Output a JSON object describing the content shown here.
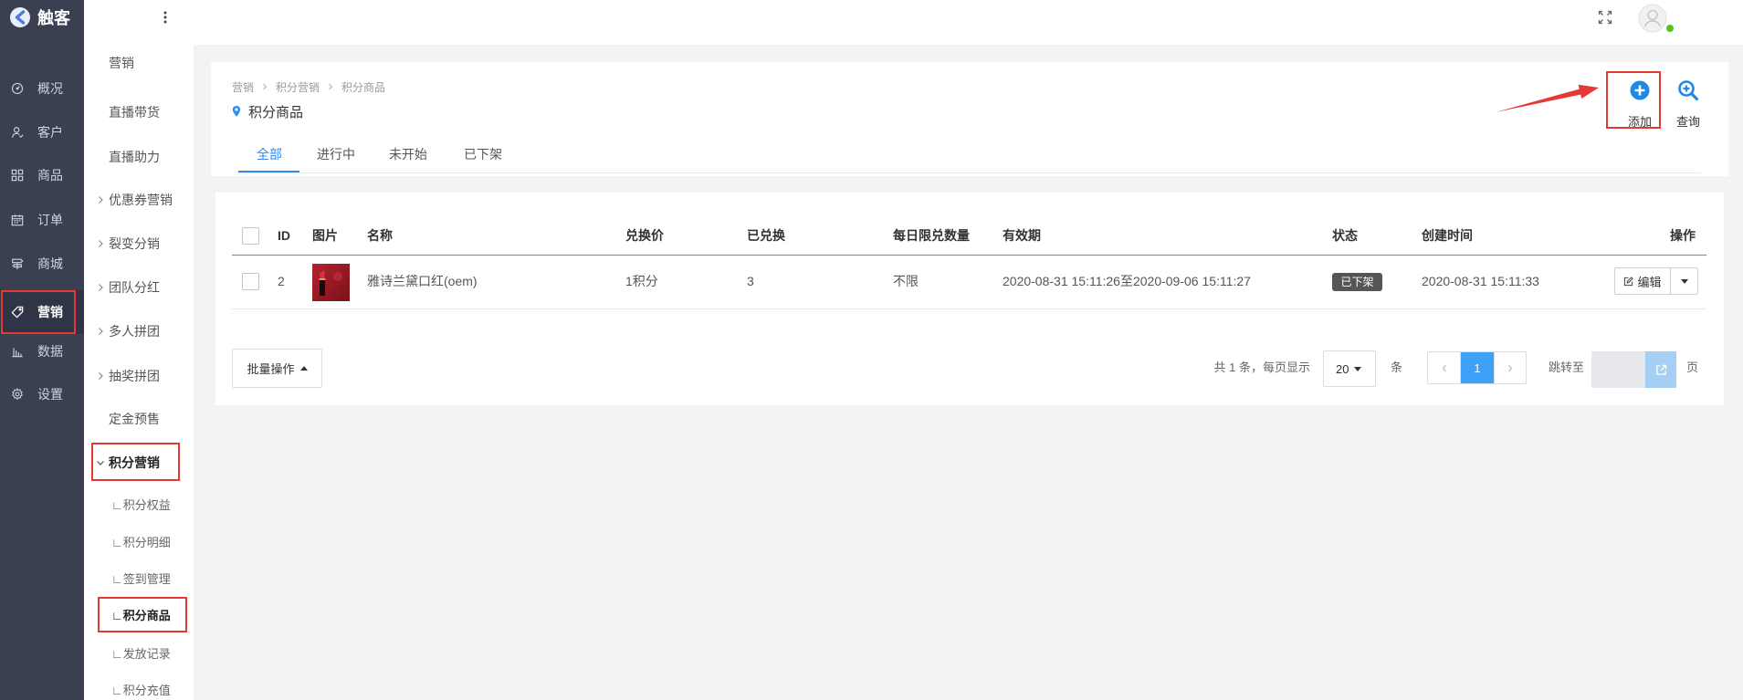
{
  "app": {
    "logo_text": "触客",
    "logo_icon": "app-logo-icon"
  },
  "colors": {
    "nav_bg": "#3a4052",
    "accent": "#2d8cf0",
    "annotation": "#e53935",
    "status_badge": "#555555",
    "online_dot": "#52c41a"
  },
  "main_nav": [
    {
      "label": "概况",
      "icon": "dashboard-icon"
    },
    {
      "label": "客户",
      "icon": "customer-icon"
    },
    {
      "label": "商品",
      "icon": "grid-icon"
    },
    {
      "label": "订单",
      "icon": "calendar-icon"
    },
    {
      "label": "商城",
      "icon": "store-icon"
    },
    {
      "label": "营销",
      "icon": "tag-icon",
      "active": true
    },
    {
      "label": "数据",
      "icon": "bar-chart-icon"
    },
    {
      "label": "设置",
      "icon": "gear-icon"
    }
  ],
  "sub_nav": [
    {
      "label": "营销"
    },
    {
      "label": "直播带货"
    },
    {
      "label": "直播助力"
    },
    {
      "label": "优惠券营销",
      "icon": "chevron-right-icon"
    },
    {
      "label": "裂变分销",
      "icon": "chevron-right-icon"
    },
    {
      "label": "团队分红",
      "icon": "chevron-right-icon"
    },
    {
      "label": "多人拼团",
      "icon": "chevron-right-icon"
    },
    {
      "label": "抽奖拼团",
      "icon": "chevron-right-icon"
    },
    {
      "label": "定金预售"
    },
    {
      "label": "积分营销",
      "icon": "chevron-down-icon",
      "expanded": true
    },
    {
      "label": "∟积分权益"
    },
    {
      "label": "∟积分明细"
    },
    {
      "label": "∟签到管理"
    },
    {
      "label": "∟积分商品",
      "active": true
    },
    {
      "label": "∟发放记录"
    },
    {
      "label": "∟积分充值"
    }
  ],
  "header": {
    "icons": [
      "more-vertical-icon",
      "fullscreen-icon",
      "user-avatar-icon"
    ]
  },
  "breadcrumb": [
    "营销",
    "积分营销",
    "积分商品"
  ],
  "page_title": "积分商品",
  "actions": {
    "add": {
      "label": "添加",
      "icon": "plus-circle-icon"
    },
    "query": {
      "label": "查询",
      "icon": "search-plus-icon"
    }
  },
  "tabs": [
    {
      "label": "全部",
      "active": true
    },
    {
      "label": "进行中"
    },
    {
      "label": "未开始"
    },
    {
      "label": "已下架"
    }
  ],
  "table": {
    "columns": [
      "ID",
      "图片",
      "名称",
      "兑换价",
      "已兑换",
      "每日限兑数量",
      "有效期",
      "状态",
      "创建时间",
      "操作"
    ],
    "rows": [
      {
        "id": "2",
        "name": "雅诗兰黛口红(oem)",
        "price": "1积分",
        "redeemed": "3",
        "daily_limit": "不限",
        "validity": "2020-08-31 15:11:26至2020-09-06 15:11:27",
        "status": "已下架",
        "created": "2020-08-31 15:11:33",
        "action": "编辑"
      }
    ]
  },
  "footer": {
    "batch_label": "批量操作",
    "total_text": "共 1 条，每页显示",
    "page_size": "20",
    "page_size_unit": "条",
    "current_page": "1",
    "jump_label": "跳转至",
    "page_unit": "页"
  }
}
